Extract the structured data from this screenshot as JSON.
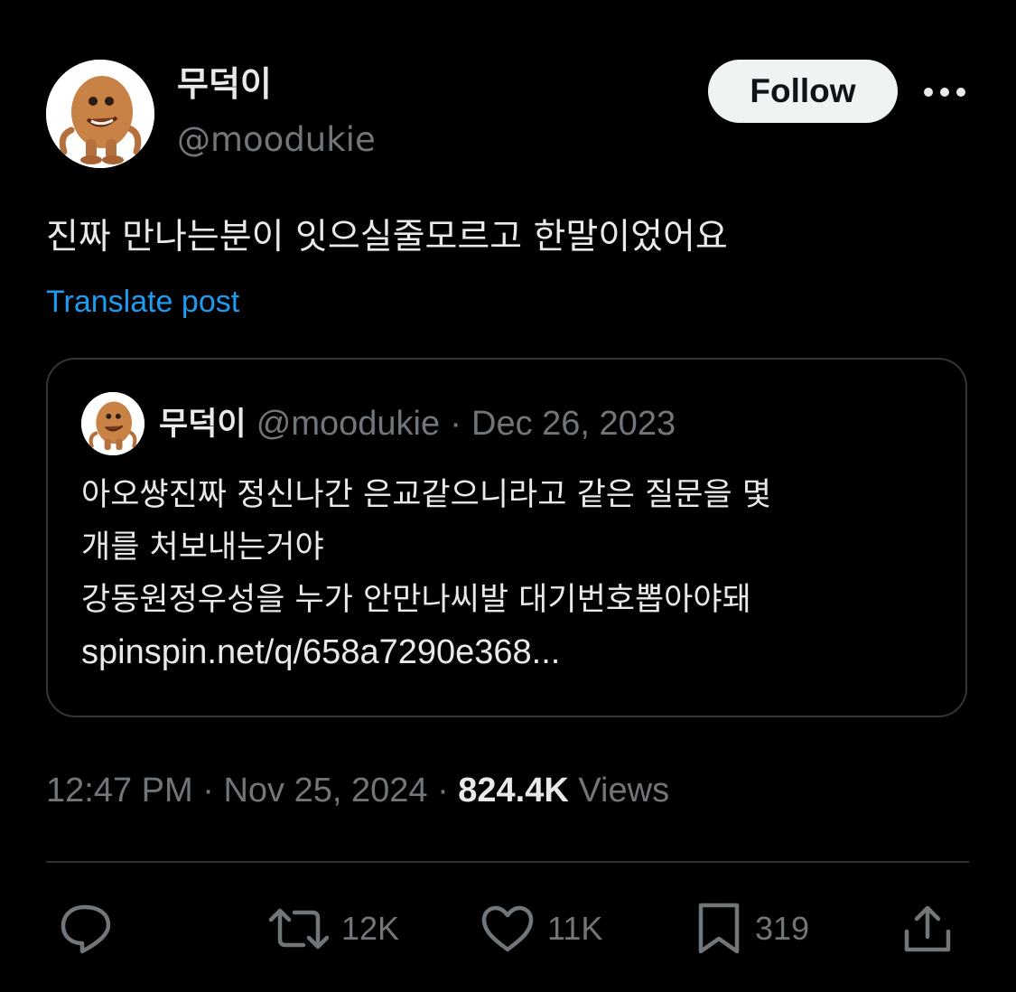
{
  "author": {
    "display_name": "무덕이",
    "handle": "@moodukie"
  },
  "header": {
    "follow_label": "Follow",
    "more_icon": "more-horizontal-icon"
  },
  "post": {
    "text": "진짜 만나는분이 잇으실줄모르고 한말이었어요",
    "translate_label": "Translate post"
  },
  "quote": {
    "display_name": "무덕이",
    "handle": "@moodukie",
    "separator": "·",
    "date": "Dec 26, 2023",
    "lines": [
      "아오썅진짜 정신나간 은교같으니라고 같은 질문을 몇",
      "개를 처보내는거야",
      "강동원정우성을 누가 안만나씨발 대기번호뽑아야돼"
    ],
    "link": "spinspin.net/q/658a7290e368..."
  },
  "meta": {
    "time": "12:47 PM",
    "sep1": "·",
    "date": "Nov 25, 2024",
    "sep2": "·",
    "views_count": "824.4K",
    "views_label": "Views"
  },
  "actions": {
    "reply_icon": "reply-icon",
    "repost_icon": "repost-icon",
    "repost_count": "12K",
    "like_icon": "heart-icon",
    "like_count": "11K",
    "bookmark_icon": "bookmark-icon",
    "bookmark_count": "319",
    "share_icon": "share-icon"
  },
  "colors": {
    "background": "#000000",
    "text_primary": "#e7e9ea",
    "text_secondary": "#71767b",
    "link": "#1d9bf0",
    "border": "#333639",
    "follow_bg": "#eff3f4"
  }
}
